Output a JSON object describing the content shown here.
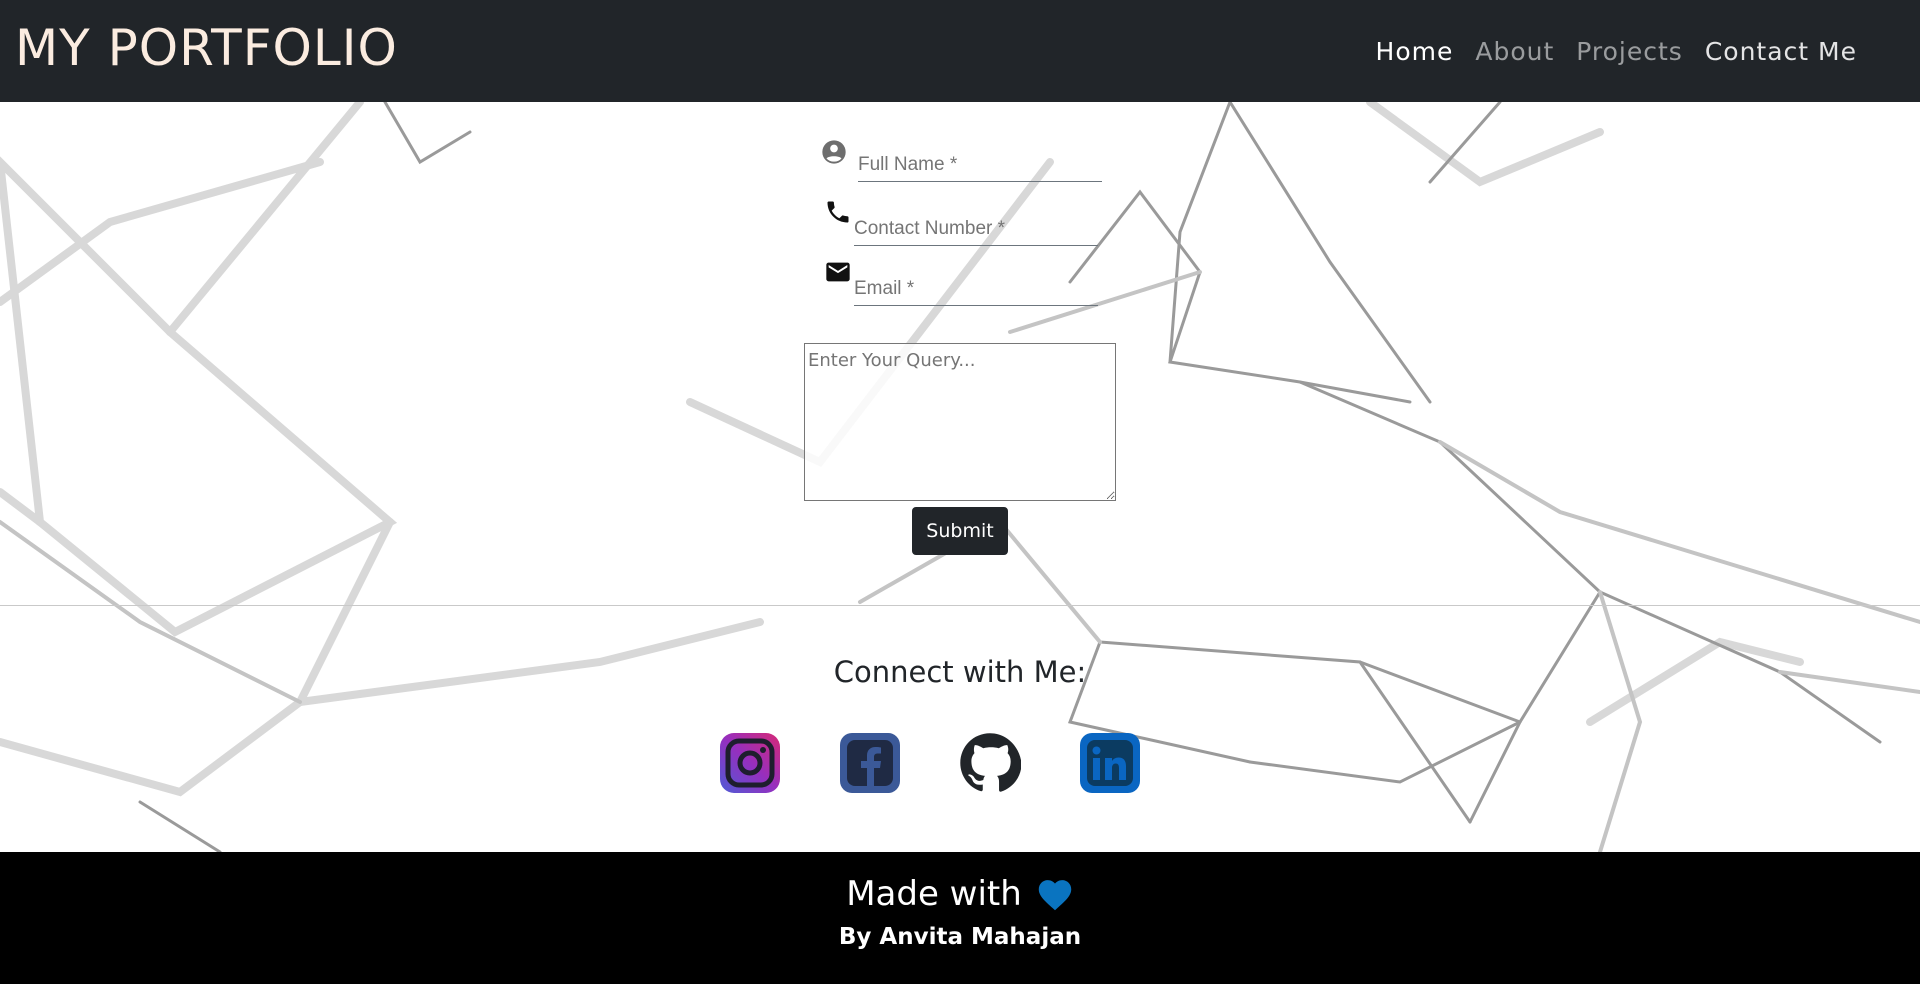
{
  "navbar": {
    "brand": "MY PORTFOLIO",
    "links": [
      {
        "label": "Home",
        "state": "active"
      },
      {
        "label": "About",
        "state": "inactive"
      },
      {
        "label": "Projects",
        "state": "inactive"
      },
      {
        "label": "Contact Me",
        "state": "highlighted"
      }
    ]
  },
  "form": {
    "full_name": {
      "placeholder": "Full Name *",
      "value": "",
      "icon": "account-circle-icon"
    },
    "contact_number": {
      "placeholder": "Contact Number *",
      "value": "",
      "icon": "phone-icon"
    },
    "email": {
      "placeholder": "Email *",
      "value": "",
      "icon": "mail-icon"
    },
    "query": {
      "placeholder": "Enter Your Query...",
      "value": ""
    },
    "submit_label": "Submit"
  },
  "connect": {
    "title": "Connect with Me:",
    "links": [
      {
        "name": "instagram-icon",
        "color": "#833ab4"
      },
      {
        "name": "facebook-icon",
        "color": "#3b5998"
      },
      {
        "name": "github-icon",
        "color": "#212529"
      },
      {
        "name": "linkedin-icon",
        "color": "#0a66c2"
      }
    ]
  },
  "footer": {
    "made_with": "Made with",
    "heart_icon": "heart-icon",
    "heart_color": "#0a74c0",
    "byline": "By Anvita Mahajan"
  },
  "colors": {
    "navbar_bg": "#212529",
    "brand_text": "#fbece0",
    "footer_bg": "#000000"
  }
}
